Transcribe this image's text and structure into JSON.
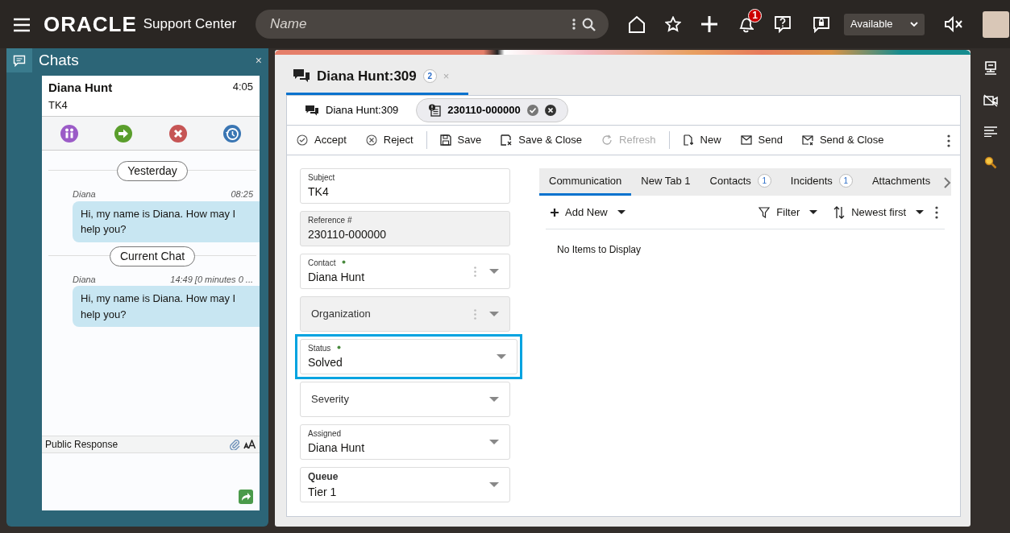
{
  "header": {
    "brand": "ORACLE",
    "app": "Support Center",
    "search": {
      "placeholder": "Name"
    },
    "notification_count": "1",
    "presence": "Available"
  },
  "chats_panel": {
    "title": "Chats",
    "close": "×",
    "session": {
      "name": "Diana Hunt",
      "subject": "TK4",
      "time": "4:05"
    },
    "transcript": [
      {
        "kind": "divider",
        "label": "Yesterday"
      },
      {
        "kind": "message",
        "sender": "Diana",
        "time": "08:25",
        "text": "Hi, my name is Diana. How may I help you?"
      },
      {
        "kind": "divider",
        "label": "Current Chat"
      },
      {
        "kind": "message",
        "sender": "Diana",
        "time": "14:49 [0 minutes 0 ...",
        "text": "Hi, my name is Diana. How may I help you?"
      }
    ],
    "composer": {
      "label": "Public Response"
    }
  },
  "workspace": {
    "tab": {
      "label": "Diana Hunt:309",
      "count": "2",
      "close": "×",
      "selected": true
    },
    "subtabs": [
      {
        "kind": "chat",
        "label": "Diana Hunt:309",
        "selected": false
      },
      {
        "kind": "incident",
        "label": "230110-000000",
        "selected": true
      }
    ],
    "toolbar": [
      [
        {
          "kind": "accept",
          "label": "Accept",
          "disabled": false
        },
        {
          "kind": "reject",
          "label": "Reject",
          "disabled": false
        }
      ],
      [
        {
          "kind": "save",
          "label": "Save",
          "disabled": false
        },
        {
          "kind": "save-close",
          "label": "Save & Close",
          "disabled": false
        },
        {
          "kind": "refresh",
          "label": "Refresh",
          "disabled": true
        }
      ],
      [
        {
          "kind": "new",
          "label": "New",
          "disabled": false
        },
        {
          "kind": "send",
          "label": "Send",
          "disabled": false
        },
        {
          "kind": "send-close",
          "label": "Send & Close",
          "disabled": false
        }
      ]
    ],
    "fields": [
      {
        "label": "Subject",
        "value": "TK4",
        "required": false,
        "readonly": false,
        "dropdown": false,
        "menu": false,
        "focused": false,
        "bold_label": false
      },
      {
        "label": "Reference #",
        "value": "230110-000000",
        "required": false,
        "readonly": true,
        "dropdown": false,
        "menu": false,
        "focused": false,
        "bold_label": false
      },
      {
        "label": "Contact",
        "value": "Diana Hunt",
        "required": true,
        "readonly": false,
        "dropdown": true,
        "menu": true,
        "focused": false,
        "bold_label": false
      },
      {
        "placeholder": "Organization",
        "required": false,
        "readonly": true,
        "dropdown": true,
        "menu": true,
        "focused": false,
        "bold_label": false
      },
      {
        "label": "Status",
        "value": "Solved",
        "required": true,
        "readonly": false,
        "dropdown": true,
        "menu": false,
        "focused": true,
        "bold_label": false
      },
      {
        "placeholder": "Severity",
        "required": false,
        "readonly": false,
        "dropdown": true,
        "menu": false,
        "focused": false,
        "bold_label": false
      },
      {
        "label": "Assigned",
        "value": "Diana Hunt",
        "required": false,
        "readonly": false,
        "dropdown": true,
        "menu": false,
        "focused": false,
        "bold_label": false
      },
      {
        "label": "Queue",
        "value": "Tier 1",
        "required": false,
        "readonly": false,
        "dropdown": true,
        "menu": false,
        "focused": false,
        "bold_label": true
      }
    ],
    "detail_tabs": [
      {
        "label": "Communication",
        "selected": true
      },
      {
        "label": "New Tab 1",
        "selected": false
      },
      {
        "label": "Contacts",
        "count": "1",
        "selected": false
      },
      {
        "label": "Incidents",
        "count": "1",
        "selected": false
      },
      {
        "label": "Attachments",
        "selected": false
      }
    ],
    "list_toolbar": {
      "add": "Add New",
      "filter": "Filter",
      "sort": "Newest first"
    },
    "empty_text": "No Items to Display"
  }
}
